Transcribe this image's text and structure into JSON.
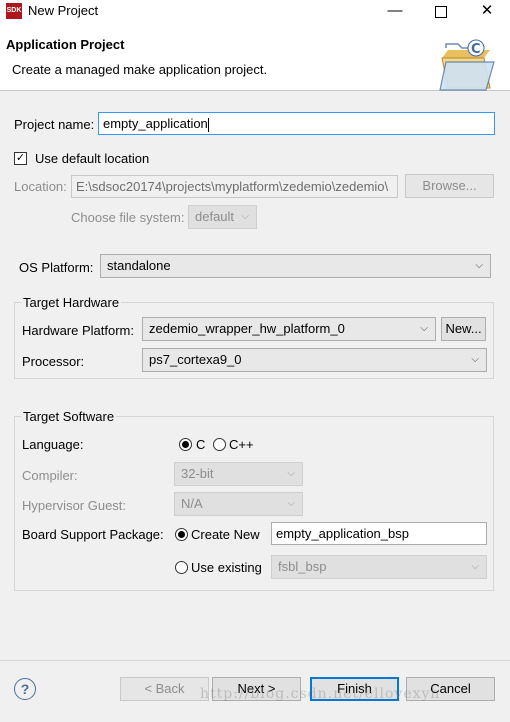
{
  "window": {
    "icon_text": "SDK",
    "title": "New Project"
  },
  "banner": {
    "title": "Application Project",
    "description": "Create a managed make application project."
  },
  "project": {
    "name_label": "Project name:",
    "name_value": "empty_application",
    "use_default_location_label": "Use default location",
    "use_default_location_checked": true,
    "location_label": "Location:",
    "location_value": "E:\\sdsoc20174\\projects\\myplatform\\zedemio\\zedemio\\",
    "browse_label": "Browse...",
    "file_system_label": "Choose file system:",
    "file_system_value": "default"
  },
  "os": {
    "label": "OS Platform:",
    "value": "standalone"
  },
  "target_hardware": {
    "group_title": "Target Hardware",
    "platform_label": "Hardware Platform:",
    "platform_value": "zedemio_wrapper_hw_platform_0",
    "new_label": "New...",
    "processor_label": "Processor:",
    "processor_value": "ps7_cortexa9_0"
  },
  "target_software": {
    "group_title": "Target Software",
    "language_label": "Language:",
    "language_options": [
      "C",
      "C++"
    ],
    "language_selected": "C",
    "compiler_label": "Compiler:",
    "compiler_value": "32-bit",
    "hypervisor_label": "Hypervisor Guest:",
    "hypervisor_value": "N/A",
    "bsp_label": "Board Support Package:",
    "create_new_label": "Create New",
    "create_new_value": "empty_application_bsp",
    "use_existing_label": "Use existing",
    "use_existing_value": "fsbl_bsp",
    "bsp_selected": "Create New"
  },
  "footer": {
    "help_glyph": "?",
    "back_label": "< Back",
    "next_label": "Next >",
    "finish_label": "Finish",
    "cancel_label": "Cancel",
    "watermark": "http://blog.csdn.net/ellovexyh"
  },
  "icons": {
    "minimize": "minimize-icon",
    "maximize": "maximize-icon",
    "close": "close-icon",
    "wizard": "new-project-folder-icon",
    "help": "help-icon",
    "dropdown": "chevron-down-icon"
  },
  "colors": {
    "focus_border": "#3399ff",
    "default_button": "#0078d7",
    "brand": "#b0161e"
  }
}
